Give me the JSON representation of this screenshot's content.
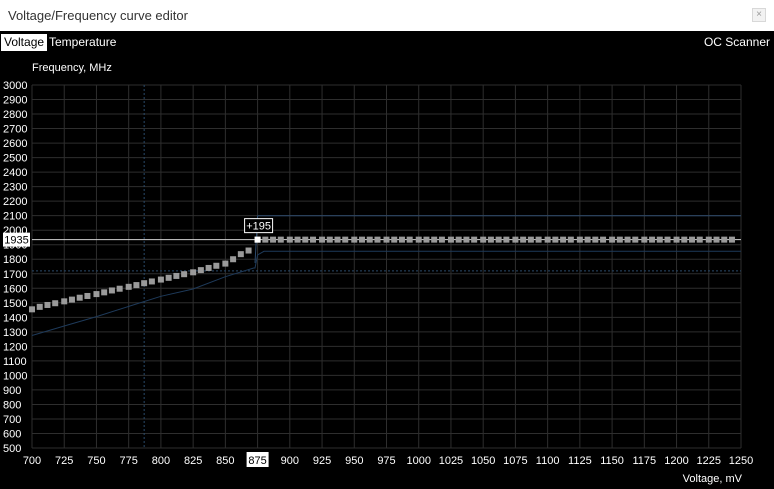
{
  "window": {
    "title": "Voltage/Frequency curve editor"
  },
  "tabs": [
    {
      "label": "Voltage",
      "active": true
    },
    {
      "label": "Temperature",
      "active": false
    }
  ],
  "oc_scanner": {
    "label": "OC Scanner"
  },
  "colors": {
    "background": "#000000",
    "grid": "#2e2e2e",
    "curve_points": "#9a9a9a",
    "selected_point": "#ffffff",
    "default_curve": "#1e3a5a",
    "guide": "#2a4a6a"
  },
  "chart_data": {
    "type": "line",
    "ylabel": "Frequency, MHz",
    "xlabel": "Voltage, mV",
    "xlim": [
      700,
      1250
    ],
    "ylim": [
      500,
      3000
    ],
    "x_ticks": [
      700,
      725,
      750,
      775,
      800,
      825,
      850,
      875,
      900,
      925,
      950,
      975,
      1000,
      1025,
      1050,
      1075,
      1100,
      1125,
      1150,
      1175,
      1200,
      1225,
      1250
    ],
    "y_ticks": [
      500,
      600,
      700,
      800,
      900,
      1000,
      1100,
      1200,
      1300,
      1400,
      1500,
      1600,
      1700,
      1800,
      1900,
      2000,
      2100,
      2200,
      2300,
      2400,
      2500,
      2600,
      2700,
      2800,
      2900,
      3000
    ],
    "grid": true,
    "highlighted_x": 875,
    "current_frequency_label": "1935",
    "offset_label": "+195",
    "selected_point": {
      "x": 875,
      "y": 1935
    },
    "series": [
      {
        "role": "curve",
        "points": [
          [
            700,
            1455
          ],
          [
            706,
            1472
          ],
          [
            712,
            1485
          ],
          [
            718,
            1497
          ],
          [
            725,
            1510
          ],
          [
            731,
            1522
          ],
          [
            737,
            1535
          ],
          [
            743,
            1547
          ],
          [
            750,
            1560
          ],
          [
            756,
            1572
          ],
          [
            762,
            1585
          ],
          [
            768,
            1597
          ],
          [
            775,
            1610
          ],
          [
            781,
            1622
          ],
          [
            787,
            1635
          ],
          [
            793,
            1647
          ],
          [
            800,
            1660
          ],
          [
            806,
            1672
          ],
          [
            812,
            1685
          ],
          [
            818,
            1697
          ],
          [
            825,
            1710
          ],
          [
            831,
            1725
          ],
          [
            837,
            1740
          ],
          [
            843,
            1755
          ],
          [
            850,
            1770
          ],
          [
            856,
            1800
          ],
          [
            862,
            1835
          ],
          [
            868,
            1860
          ],
          [
            875,
            1935
          ],
          [
            881,
            1935
          ],
          [
            887,
            1935
          ],
          [
            893,
            1935
          ],
          [
            900,
            1935
          ],
          [
            906,
            1935
          ],
          [
            912,
            1935
          ],
          [
            918,
            1935
          ],
          [
            925,
            1935
          ],
          [
            931,
            1935
          ],
          [
            937,
            1935
          ],
          [
            943,
            1935
          ],
          [
            950,
            1935
          ],
          [
            956,
            1935
          ],
          [
            962,
            1935
          ],
          [
            968,
            1935
          ],
          [
            975,
            1935
          ],
          [
            981,
            1935
          ],
          [
            987,
            1935
          ],
          [
            993,
            1935
          ],
          [
            1000,
            1935
          ],
          [
            1006,
            1935
          ],
          [
            1012,
            1935
          ],
          [
            1018,
            1935
          ],
          [
            1025,
            1935
          ],
          [
            1031,
            1935
          ],
          [
            1037,
            1935
          ],
          [
            1043,
            1935
          ],
          [
            1050,
            1935
          ],
          [
            1056,
            1935
          ],
          [
            1062,
            1935
          ],
          [
            1068,
            1935
          ],
          [
            1075,
            1935
          ],
          [
            1081,
            1935
          ],
          [
            1087,
            1935
          ],
          [
            1093,
            1935
          ],
          [
            1100,
            1935
          ],
          [
            1106,
            1935
          ],
          [
            1112,
            1935
          ],
          [
            1118,
            1935
          ],
          [
            1125,
            1935
          ],
          [
            1131,
            1935
          ],
          [
            1137,
            1935
          ],
          [
            1143,
            1935
          ],
          [
            1150,
            1935
          ],
          [
            1156,
            1935
          ],
          [
            1162,
            1935
          ],
          [
            1168,
            1935
          ],
          [
            1175,
            1935
          ],
          [
            1181,
            1935
          ],
          [
            1187,
            1935
          ],
          [
            1193,
            1935
          ],
          [
            1200,
            1935
          ],
          [
            1206,
            1935
          ],
          [
            1212,
            1935
          ],
          [
            1218,
            1935
          ],
          [
            1225,
            1935
          ],
          [
            1231,
            1935
          ],
          [
            1237,
            1935
          ],
          [
            1243,
            1935
          ]
        ]
      },
      {
        "role": "default-curve",
        "points": [
          [
            700,
            1275
          ],
          [
            725,
            1340
          ],
          [
            750,
            1405
          ],
          [
            775,
            1475
          ],
          [
            800,
            1545
          ],
          [
            825,
            1595
          ],
          [
            850,
            1680
          ],
          [
            872,
            1740
          ],
          [
            873,
            1740
          ],
          [
            875,
            1830
          ],
          [
            880,
            1855
          ],
          [
            900,
            1855
          ],
          [
            1000,
            1855
          ],
          [
            1100,
            1855
          ],
          [
            1200,
            1855
          ],
          [
            1250,
            1855
          ]
        ]
      },
      {
        "role": "upper-limit",
        "points": [
          [
            873,
            1775
          ],
          [
            875,
            2100
          ],
          [
            1250,
            2100
          ]
        ]
      }
    ],
    "guides": {
      "vertical_x": 787,
      "horizontal_y": 1720
    }
  }
}
